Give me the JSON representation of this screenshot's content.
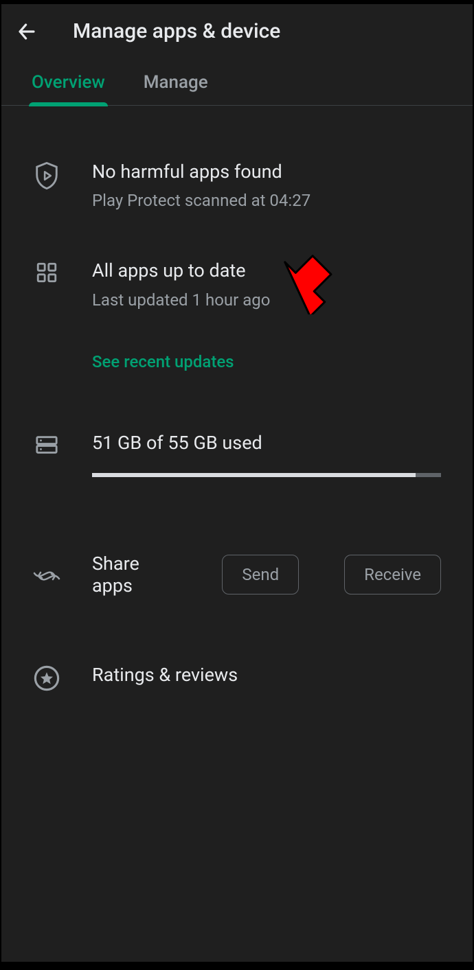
{
  "header": {
    "title": "Manage apps & device"
  },
  "tabs": {
    "overview": "Overview",
    "manage": "Manage"
  },
  "protect": {
    "title": "No harmful apps found",
    "sub": "Play Protect scanned at 04:27"
  },
  "updates": {
    "title": "All apps up to date",
    "sub": "Last updated 1 hour ago",
    "link": "See recent updates"
  },
  "storage": {
    "title": "51 GB of 55 GB used",
    "used_gb": 51,
    "total_gb": 55,
    "percent": 92.7
  },
  "share": {
    "label": "Share apps",
    "send": "Send",
    "receive": "Receive"
  },
  "ratings": {
    "title": "Ratings & reviews"
  }
}
